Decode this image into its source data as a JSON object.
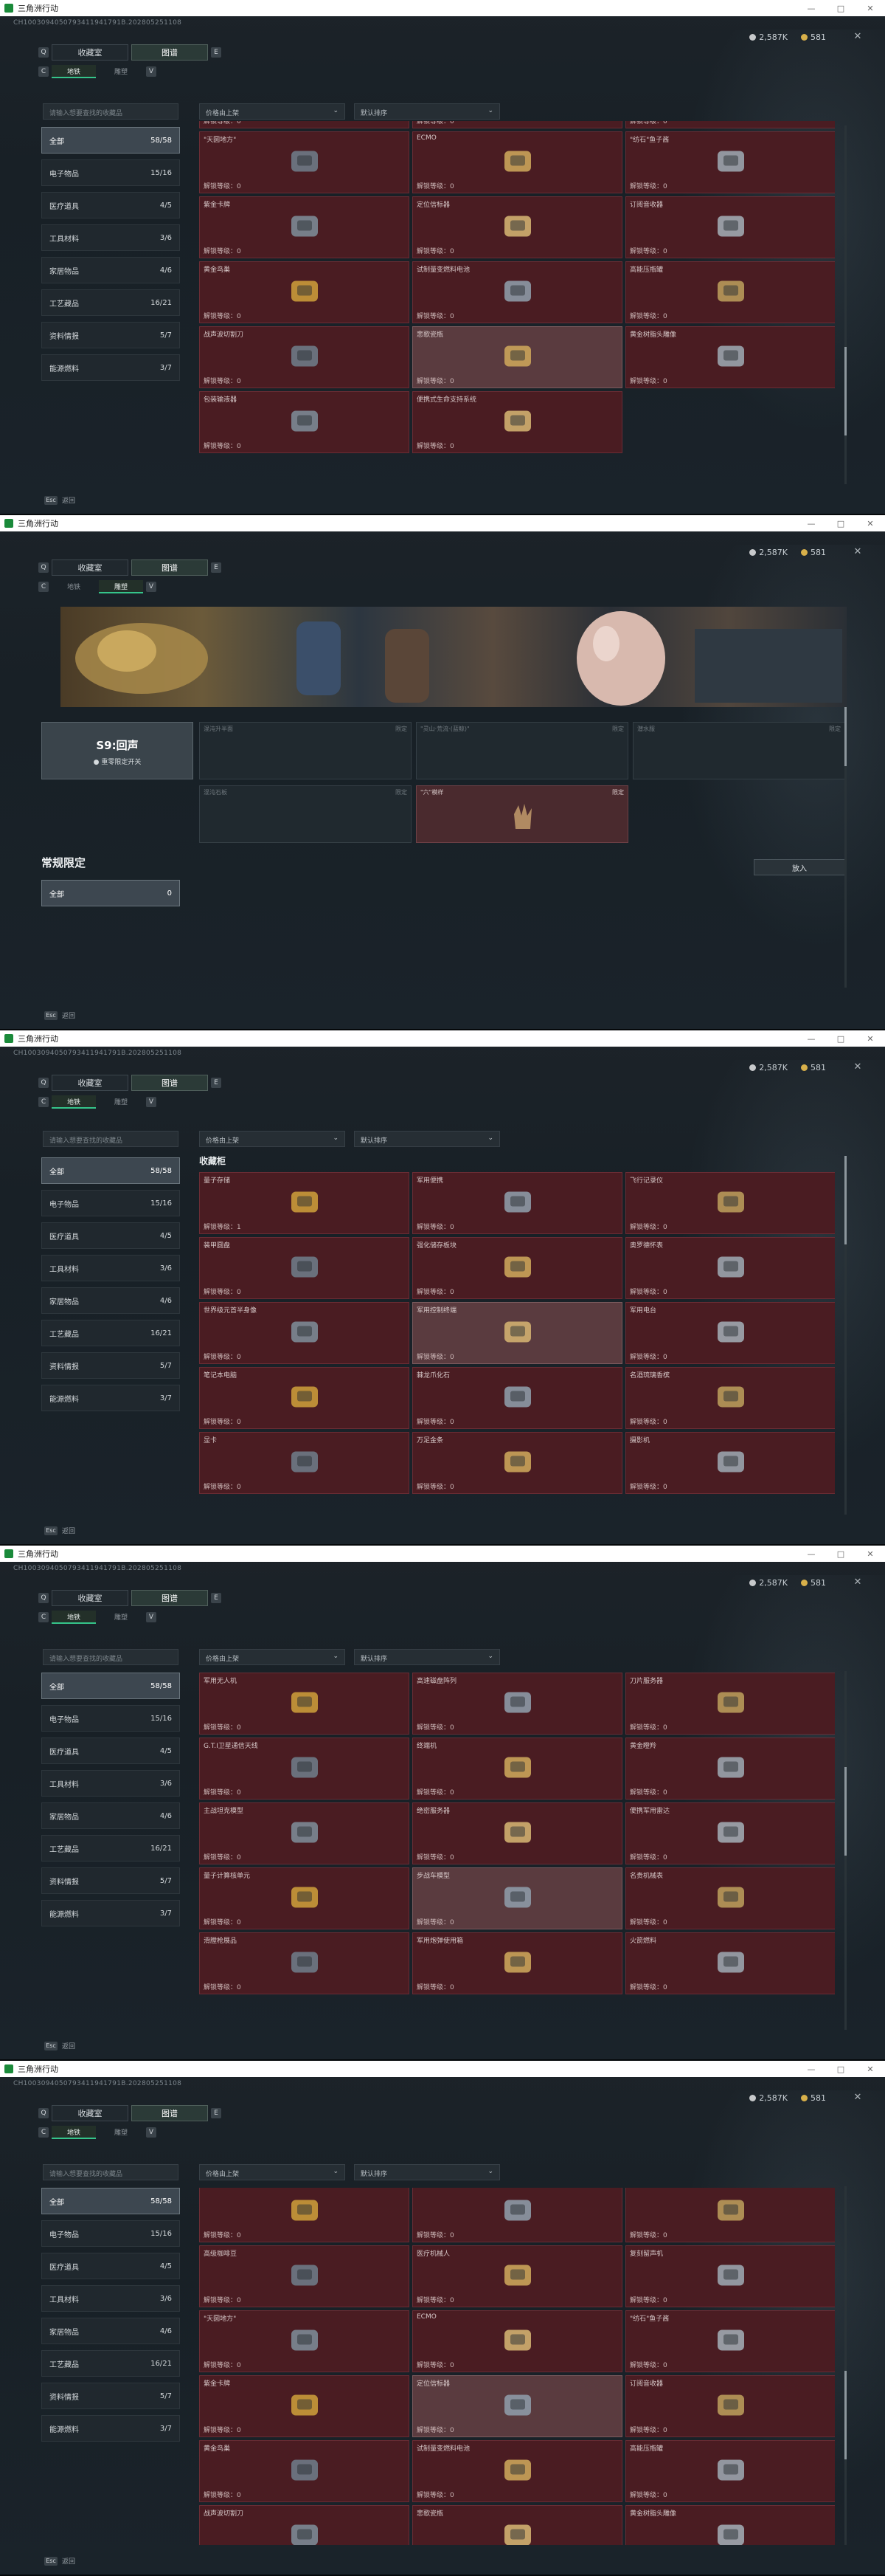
{
  "window": {
    "title": "三角洲行动",
    "build": "CH1003094050793411941791B.202805251108",
    "controls": [
      "—",
      "□",
      "✕"
    ]
  },
  "currency": [
    {
      "value": "2,587K",
      "color": "#c7c9cb"
    },
    {
      "value": "581",
      "color": "#d8b04a"
    }
  ],
  "tabs": {
    "key_left": "Q",
    "key_right": "E",
    "items": [
      "收藏室",
      "图谱"
    ],
    "active": 1
  },
  "subtabs": {
    "key_left": "C",
    "key_right": "V",
    "items": [
      "地铁",
      "雕塑"
    ]
  },
  "filters": {
    "search_placeholder": "请输入想要查找的收藏品",
    "sort": "价格由上架",
    "order": "默认排序"
  },
  "sidebar": [
    {
      "label": "全部",
      "count": "58/58"
    },
    {
      "label": "电子物品",
      "count": "15/16"
    },
    {
      "label": "医疗道具",
      "count": "4/5"
    },
    {
      "label": "工具材料",
      "count": "3/6"
    },
    {
      "label": "家居物品",
      "count": "4/6"
    },
    {
      "label": "工艺藏品",
      "count": "16/21"
    },
    {
      "label": "资料情报",
      "count": "5/7"
    },
    {
      "label": "能源燃料",
      "count": "3/7"
    }
  ],
  "footer": {
    "key": "Esc",
    "label": "返回"
  },
  "section_title": "收藏柜",
  "level_label_prefix": "解锁等级：",
  "frame1_cards": [
    {
      "name": "",
      "level": "解锁等级：0"
    },
    {
      "name": "",
      "level": "解锁等级：0"
    },
    {
      "name": "",
      "level": "解锁等级：0"
    },
    {
      "name": "\"天圆地方\"",
      "level": "解锁等级：0"
    },
    {
      "name": "ECMO",
      "level": "解锁等级：0"
    },
    {
      "name": "\"纺石\"鱼子酱",
      "level": "解锁等级：0"
    },
    {
      "name": "紫金卡牌",
      "level": "解锁等级：0"
    },
    {
      "name": "定位信标器",
      "level": "解锁等级：0"
    },
    {
      "name": "订阅音收器",
      "level": "解锁等级：0"
    },
    {
      "name": "黄金鸟巢",
      "level": "解锁等级：0"
    },
    {
      "name": "试制量变燃料电池",
      "level": "解锁等级：0"
    },
    {
      "name": "高能压瓶罐",
      "level": "解锁等级：0"
    },
    {
      "name": "战声波切割刀",
      "level": "解锁等级：0"
    },
    {
      "name": "悲歌瓷瓶",
      "level": "解锁等级：0"
    },
    {
      "name": "黄金树脂头雕像",
      "level": "解锁等级：0"
    },
    {
      "name": "包装输液器",
      "level": "解锁等级：0"
    },
    {
      "name": "便携式生命支持系统",
      "level": "解锁等级：0"
    }
  ],
  "frame3_cards": [
    {
      "name": "量子存储",
      "level": "解锁等级：1"
    },
    {
      "name": "军用便携",
      "level": "解锁等级：0"
    },
    {
      "name": "飞行记录仪",
      "level": "解锁等级：0"
    },
    {
      "name": "装甲圆盘",
      "level": "解锁等级：0"
    },
    {
      "name": "强化储存板块",
      "level": "解锁等级：0"
    },
    {
      "name": "奥罗德怀表",
      "level": "解锁等级：0"
    },
    {
      "name": "世界级元首半身像",
      "level": "解锁等级：0"
    },
    {
      "name": "军用控制终端",
      "level": "解锁等级：0"
    },
    {
      "name": "军用电台",
      "level": "解锁等级：0"
    },
    {
      "name": "笔记本电脑",
      "level": "解锁等级：0"
    },
    {
      "name": "棘龙爪化石",
      "level": "解锁等级：0"
    },
    {
      "name": "名酒琉璃香槟",
      "level": "解锁等级：0"
    },
    {
      "name": "显卡",
      "level": "解锁等级：0"
    },
    {
      "name": "万足金条",
      "level": "解锁等级：0"
    },
    {
      "name": "摄影机",
      "level": "解锁等级：0"
    }
  ],
  "frame4_cards": [
    {
      "name": "军用无人机",
      "level": "解锁等级：0"
    },
    {
      "name": "高速磁盘阵列",
      "level": "解锁等级：0"
    },
    {
      "name": "刀片服务器",
      "level": "解锁等级：0"
    },
    {
      "name": "G.T.I卫星通信天线",
      "level": "解锁等级：0"
    },
    {
      "name": "终端机",
      "level": "解锁等级：0"
    },
    {
      "name": "黄金瞪羚",
      "level": "解锁等级：0"
    },
    {
      "name": "主战坦克模型",
      "level": "解锁等级：0"
    },
    {
      "name": "绝密服务器",
      "level": "解锁等级：0"
    },
    {
      "name": "便携军用雷达",
      "level": "解锁等级：0"
    },
    {
      "name": "量子计算核单元",
      "level": "解锁等级：0"
    },
    {
      "name": "步战车模型",
      "level": "解锁等级：0"
    },
    {
      "name": "名贵机械表",
      "level": "解锁等级：0"
    },
    {
      "name": "滑膛枪展品",
      "level": "解锁等级：0"
    },
    {
      "name": "军用炮弹使用箱",
      "level": "解锁等级：0"
    },
    {
      "name": "火箭燃料",
      "level": "解锁等级：0"
    }
  ],
  "frame5_cards": [
    {
      "name": "",
      "level": "解锁等级：0"
    },
    {
      "name": "",
      "level": "解锁等级：0"
    },
    {
      "name": "",
      "level": "解锁等级：0"
    },
    {
      "name": "高级咖啡豆",
      "level": "解锁等级：0"
    },
    {
      "name": "医疗机械人",
      "level": "解锁等级：0"
    },
    {
      "name": "复刻留声机",
      "level": "解锁等级：0"
    },
    {
      "name": "\"天圆地方\"",
      "level": "解锁等级：0"
    },
    {
      "name": "ECMO",
      "level": "解锁等级：0"
    },
    {
      "name": "\"纺石\"鱼子酱",
      "level": "解锁等级：0"
    },
    {
      "name": "紫金卡牌",
      "level": "解锁等级：0"
    },
    {
      "name": "定位信标器",
      "level": "解锁等级：0"
    },
    {
      "name": "订阅音收器",
      "level": "解锁等级：0"
    },
    {
      "name": "黄金鸟巢",
      "level": "解锁等级：0"
    },
    {
      "name": "试制量变燃料电池",
      "level": "解锁等级：0"
    },
    {
      "name": "高能压瓶罐",
      "level": "解锁等级：0"
    },
    {
      "name": "战声波切割刀",
      "level": "解锁等级：0"
    },
    {
      "name": "悲歌瓷瓶",
      "level": "解锁等级：0"
    },
    {
      "name": "黄金树脂头雕像",
      "level": "解锁等级：0"
    }
  ],
  "season": {
    "title": "S9:回声",
    "subtitle": "● 重零限定开关",
    "slots": [
      {
        "name": "混沌升半面",
        "tag": "限定"
      },
      {
        "name": "\"灵山·荒流·(蓝鲸)\"",
        "tag": "限定"
      },
      {
        "name": "潜水服",
        "tag": "限定"
      },
      {
        "name": "混沌石板",
        "tag": "限定"
      },
      {
        "name": "\"六\"模样",
        "tag": "限定"
      }
    ]
  },
  "regular": {
    "title": "常规限定",
    "place_button": "放入",
    "item": {
      "label": "全部",
      "count": "0"
    }
  }
}
